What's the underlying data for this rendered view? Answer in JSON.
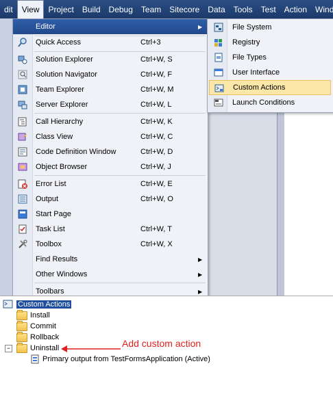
{
  "menubar": {
    "items": [
      "dit",
      "View",
      "Project",
      "Build",
      "Debug",
      "Team",
      "Sitecore",
      "Data",
      "Tools",
      "Test",
      "Action",
      "Window"
    ]
  },
  "view_menu": {
    "editor": "Editor",
    "quick_access": {
      "label": "Quick Access",
      "shortcut": "Ctrl+3"
    },
    "solution_explorer": {
      "label": "Solution Explorer",
      "shortcut": "Ctrl+W, S"
    },
    "solution_navigator": {
      "label": "Solution Navigator",
      "shortcut": "Ctrl+W, F"
    },
    "team_explorer": {
      "label": "Team Explorer",
      "shortcut": "Ctrl+W, M"
    },
    "server_explorer": {
      "label": "Server Explorer",
      "shortcut": "Ctrl+W, L"
    },
    "call_hierarchy": {
      "label": "Call Hierarchy",
      "shortcut": "Ctrl+W, K"
    },
    "class_view": {
      "label": "Class View",
      "shortcut": "Ctrl+W, C"
    },
    "code_definition": {
      "label": "Code Definition Window",
      "shortcut": "Ctrl+W, D"
    },
    "object_browser": {
      "label": "Object Browser",
      "shortcut": "Ctrl+W, J"
    },
    "error_list": {
      "label": "Error List",
      "shortcut": "Ctrl+W, E"
    },
    "output": {
      "label": "Output",
      "shortcut": "Ctrl+W, O"
    },
    "start_page": {
      "label": "Start Page",
      "shortcut": ""
    },
    "task_list": {
      "label": "Task List",
      "shortcut": "Ctrl+W, T"
    },
    "toolbox": {
      "label": "Toolbox",
      "shortcut": "Ctrl+W, X"
    },
    "find_results": "Find Results",
    "other_windows": "Other Windows",
    "toolbars": "Toolbars"
  },
  "editor_submenu": {
    "items": [
      "File System",
      "Registry",
      "File Types",
      "User Interface",
      "Custom Actions",
      "Launch Conditions"
    ]
  },
  "tree": {
    "root": "Custom Actions",
    "install": "Install",
    "commit": "Commit",
    "rollback": "Rollback",
    "uninstall": "Uninstall",
    "primary_output": "Primary output from TestFormsApplication (Active)"
  },
  "annotation": "Add custom action",
  "colors": {
    "accent": "#2f5fa8",
    "highlight": "#fbe7a8",
    "annotation": "#e02020"
  }
}
